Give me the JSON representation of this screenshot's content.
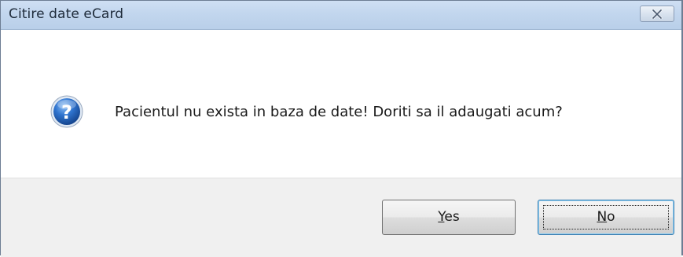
{
  "window": {
    "title": "Citire date eCard",
    "close_icon": "close-icon"
  },
  "message": {
    "icon": "question-icon",
    "text": "Pacientul nu exista in baza de date! Doriti sa il adaugati acum?"
  },
  "buttons": {
    "yes": {
      "accel": "Y",
      "rest": "es"
    },
    "no": {
      "accel": "N",
      "rest": "o"
    }
  },
  "colors": {
    "titlebar": "#c2d6ee",
    "footer": "#f0f0f0",
    "icon_blue": "#1f5fb3"
  }
}
